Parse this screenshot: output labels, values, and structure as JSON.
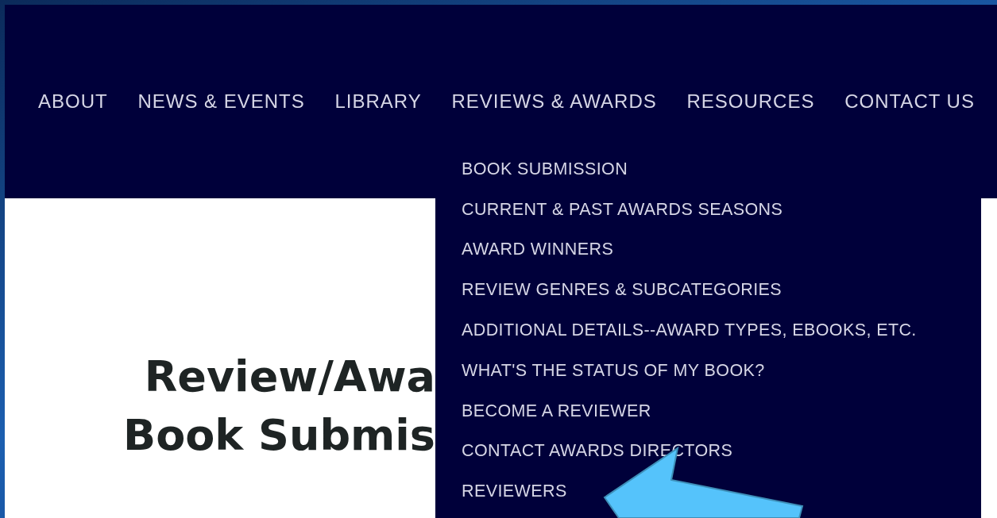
{
  "nav": {
    "items": [
      {
        "label": "ABOUT"
      },
      {
        "label": "NEWS & EVENTS"
      },
      {
        "label": "LIBRARY"
      },
      {
        "label": "REVIEWS & AWARDS"
      },
      {
        "label": "RESOURCES"
      },
      {
        "label": "CONTACT US"
      }
    ]
  },
  "dropdown": {
    "items": [
      {
        "label": "BOOK SUBMISSION"
      },
      {
        "label": "CURRENT & PAST AWARDS SEASONS"
      },
      {
        "label": "AWARD WINNERS"
      },
      {
        "label": "REVIEW GENRES & SUBCATEGORIES"
      },
      {
        "label": "ADDITIONAL DETAILS--AWARD TYPES, EBOOKS, ETC."
      },
      {
        "label": "WHAT'S THE STATUS OF MY BOOK?"
      },
      {
        "label": "BECOME A REVIEWER"
      },
      {
        "label": "CONTACT AWARDS DIRECTORS"
      },
      {
        "label": "REVIEWERS"
      }
    ]
  },
  "content": {
    "heading_lines": [
      "Review/Awa",
      "Book Submis"
    ]
  }
}
